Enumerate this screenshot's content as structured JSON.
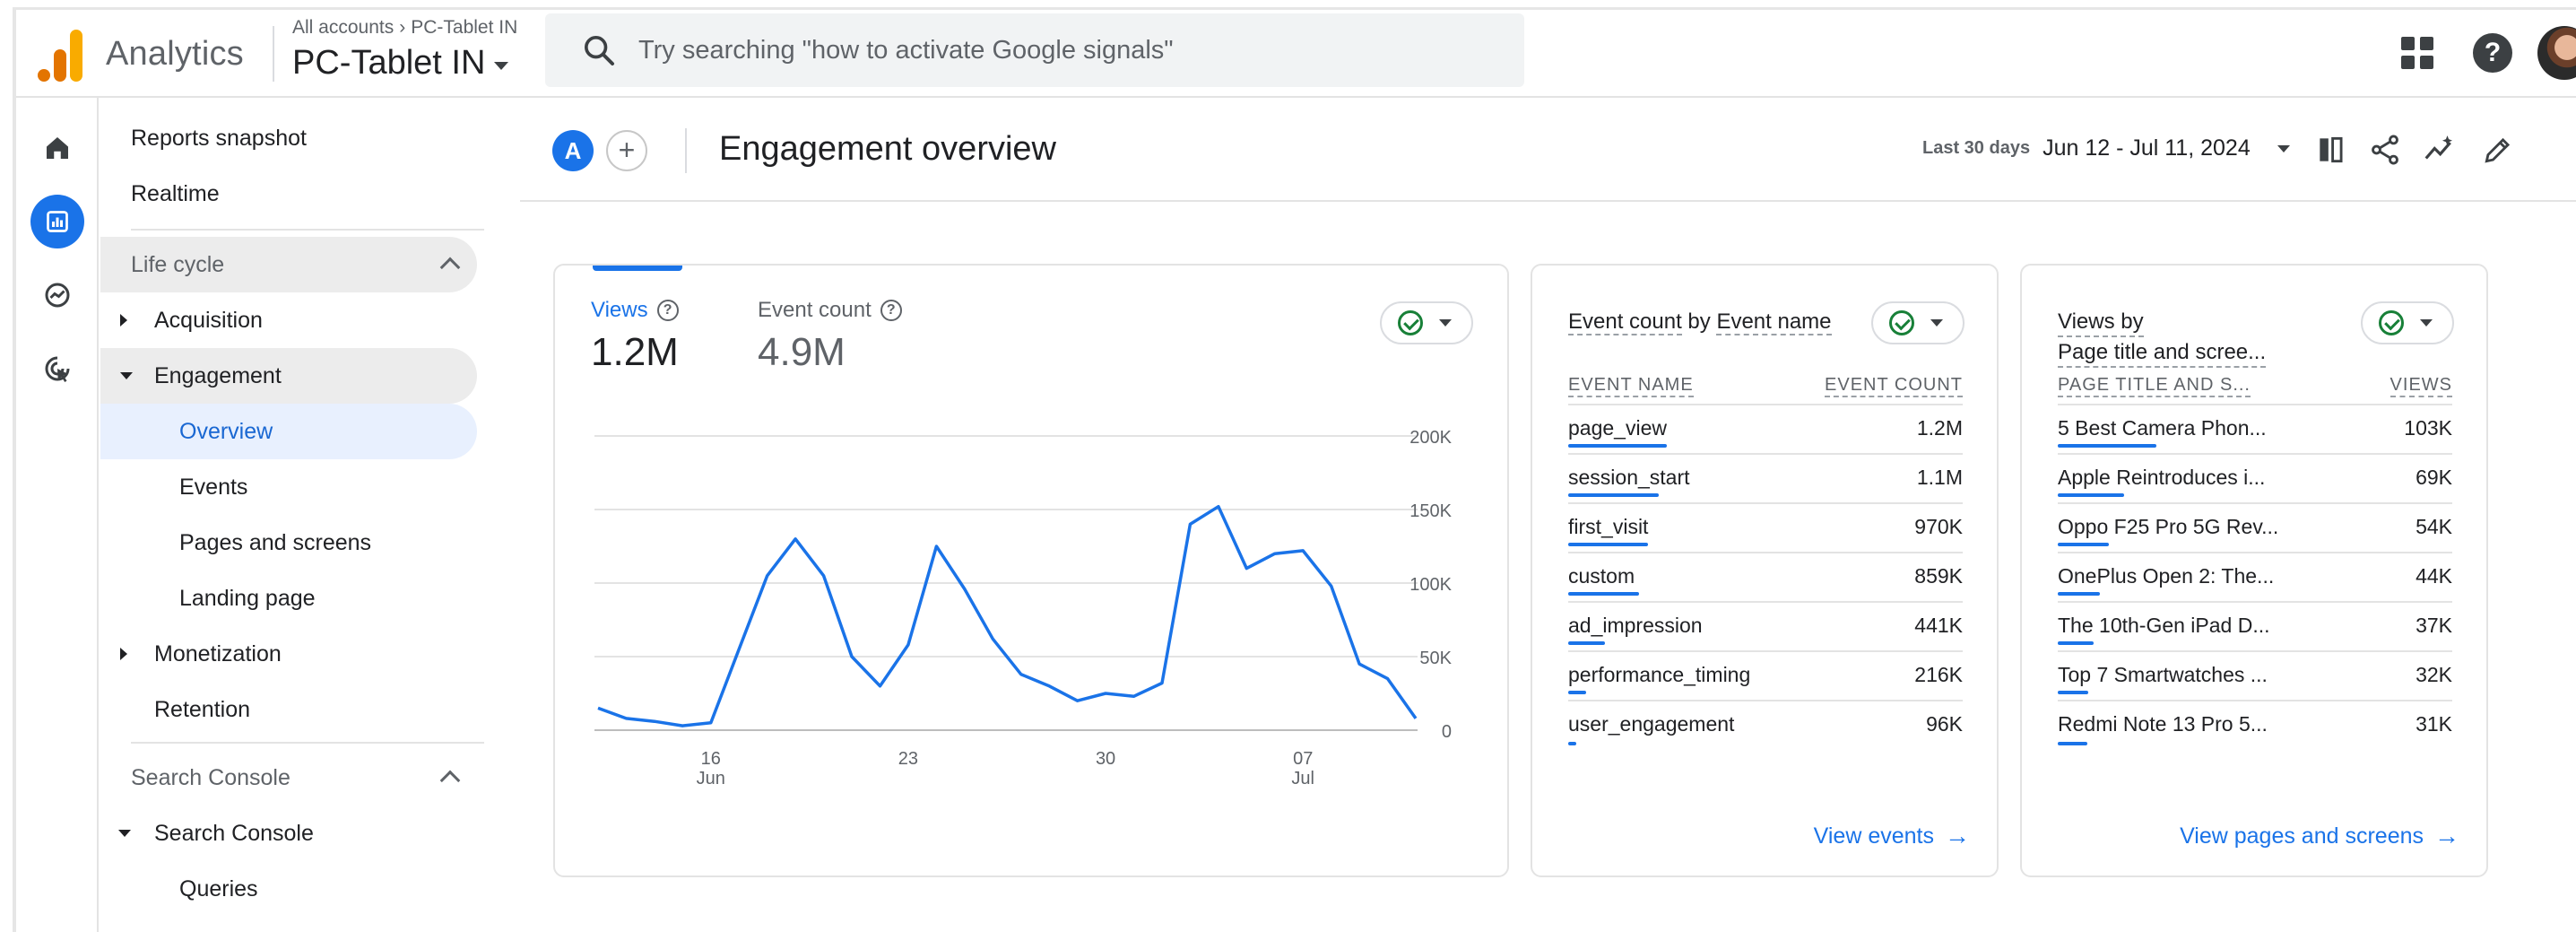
{
  "app": {
    "name": "Analytics",
    "account_path": [
      "All accounts",
      "PC-Tablet IN"
    ],
    "property": "PC-Tablet IN"
  },
  "search": {
    "placeholder": "Try searching \"how to activate Google signals\""
  },
  "nav": {
    "top_items": [
      "Reports snapshot",
      "Realtime"
    ],
    "lifecycle": {
      "label": "Life cycle",
      "acquisition": "Acquisition",
      "engagement": "Engagement",
      "engagement_children": [
        "Overview",
        "Events",
        "Pages and screens",
        "Landing page"
      ],
      "monetization": "Monetization",
      "retention": "Retention"
    },
    "search_console": {
      "label": "Search Console",
      "item": "Search Console",
      "children": [
        "Queries"
      ]
    }
  },
  "header": {
    "comparison_letter": "A",
    "add_label": "+",
    "title": "Engagement overview",
    "date_label": "Last 30 days",
    "date_value": "Jun 12 - Jul 11, 2024"
  },
  "main_card": {
    "metrics": [
      {
        "label": "Views",
        "value": "1.2M"
      },
      {
        "label": "Event count",
        "value": "4.9M"
      }
    ]
  },
  "chart_data": {
    "type": "line",
    "title": "",
    "xlabel": "",
    "ylabel": "",
    "x_ticks": [
      {
        "day": "16",
        "month": "Jun",
        "index": 4
      },
      {
        "day": "23",
        "month": "",
        "index": 11
      },
      {
        "day": "30",
        "month": "",
        "index": 18
      },
      {
        "day": "07",
        "month": "Jul",
        "index": 25
      }
    ],
    "y_ticks": [
      "0",
      "50K",
      "100K",
      "150K",
      "200K"
    ],
    "ylim": [
      0,
      200000
    ],
    "series": [
      {
        "values": [
          15000,
          8000,
          6000,
          3000,
          5000,
          55000,
          105000,
          130000,
          105000,
          50000,
          30000,
          58000,
          125000,
          96000,
          62000,
          38000,
          30000,
          20000,
          25000,
          23000,
          32000,
          140000,
          152000,
          110000,
          120000,
          122000,
          98000,
          45000,
          35000,
          8000
        ]
      }
    ],
    "color": "#1a73e8"
  },
  "events_card": {
    "title_parts": [
      "Event count",
      " by ",
      "Event name"
    ],
    "col1": "EVENT NAME",
    "col2": "EVENT COUNT",
    "rows": [
      {
        "name": "page_view",
        "value": "1.2M",
        "frac": 1.0
      },
      {
        "name": "session_start",
        "value": "1.1M",
        "frac": 0.92
      },
      {
        "name": "first_visit",
        "value": "970K",
        "frac": 0.81
      },
      {
        "name": "custom",
        "value": "859K",
        "frac": 0.72
      },
      {
        "name": "ad_impression",
        "value": "441K",
        "frac": 0.37
      },
      {
        "name": "performance_timing",
        "value": "216K",
        "frac": 0.18
      },
      {
        "name": "user_engagement",
        "value": "96K",
        "frac": 0.08
      }
    ],
    "link": "View events"
  },
  "pages_card": {
    "title_line1": "Views by",
    "title_line2": "Page title and scree...",
    "col1": "PAGE TITLE AND S...",
    "col2": "VIEWS",
    "rows": [
      {
        "name": "5 Best Camera Phon...",
        "value": "103K",
        "frac": 1.0
      },
      {
        "name": "Apple Reintroduces i...",
        "value": "69K",
        "frac": 0.67
      },
      {
        "name": "Oppo F25 Pro 5G Rev...",
        "value": "54K",
        "frac": 0.52
      },
      {
        "name": "OnePlus Open 2: The...",
        "value": "44K",
        "frac": 0.43
      },
      {
        "name": "The 10th-Gen iPad D...",
        "value": "37K",
        "frac": 0.36
      },
      {
        "name": "Top 7 Smartwatches ...",
        "value": "32K",
        "frac": 0.31
      },
      {
        "name": "Redmi Note 13 Pro 5...",
        "value": "31K",
        "frac": 0.3
      }
    ],
    "link": "View pages and screens"
  },
  "colors": {
    "accent": "#1a73e8",
    "logo_orange": "#e37400",
    "logo_yellow": "#f9ab00",
    "check_green": "#188038"
  },
  "icons": {
    "rail": [
      "home-icon",
      "reports-icon",
      "explore-icon",
      "advertising-icon"
    ],
    "toolbar": [
      "compare-icon",
      "share-icon",
      "insights-icon",
      "edit-icon"
    ]
  }
}
